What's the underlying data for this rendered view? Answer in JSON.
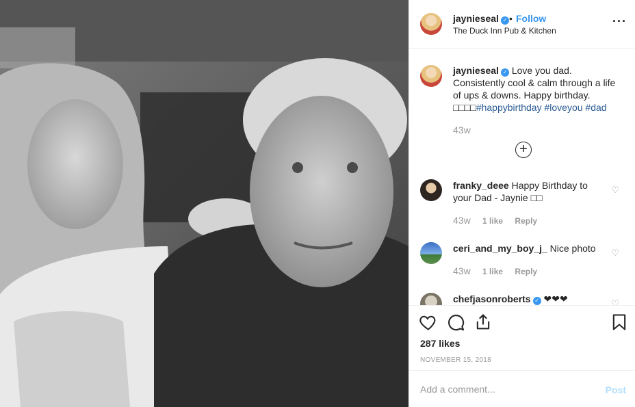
{
  "header": {
    "username": "jaynieseal",
    "follow_label": "Follow",
    "separator": "•",
    "location": "The Duck Inn Pub & Kitchen",
    "more_icon": "more-horizontal-icon"
  },
  "caption": {
    "username": "jaynieseal",
    "text": "Love you dad. Consistently cool & calm through a life of ups & downs. Happy birthday. ",
    "emoji": "□□□□",
    "hashtags": [
      "#happybirthday",
      "#loveyou",
      "#dad"
    ],
    "time": "43w"
  },
  "load_more_icon": "plus-circle-icon",
  "comments": [
    {
      "username": "franky_deee",
      "text": "Happy Birthday to your Dad - Jaynie □□",
      "time": "43w",
      "likes": "1 like",
      "reply": "Reply"
    },
    {
      "username": "ceri_and_my_boy_j_",
      "text": "Nice photo",
      "time": "43w",
      "likes": "1 like",
      "reply": "Reply"
    },
    {
      "username": "chefjasonroberts",
      "text": "❤❤❤",
      "verified": true
    }
  ],
  "actions": {
    "like_icon": "heart-icon",
    "comment_icon": "comment-icon",
    "share_icon": "share-icon",
    "save_icon": "bookmark-icon"
  },
  "likes": "287 likes",
  "date": "NOVEMBER 15, 2018",
  "add_comment": {
    "placeholder": "Add a comment...",
    "post_label": "Post"
  },
  "colors": {
    "link": "#3897f0",
    "muted": "#999999",
    "post_disabled": "#b2dffc"
  }
}
